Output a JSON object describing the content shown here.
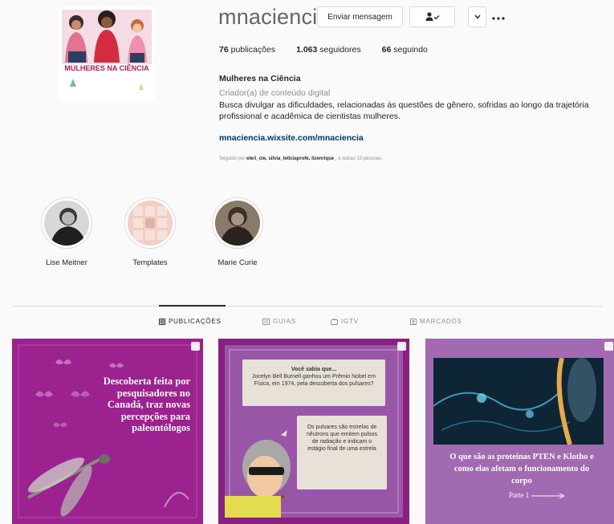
{
  "profile": {
    "username": "mnaciencia",
    "picture_text": "MULHERES NA CIÊNCIA",
    "buttons": {
      "message": "Enviar mensagem",
      "follow_icon": "person-check-icon",
      "more_icon": "chevron-down-icon",
      "options_icon": "ellipsis-icon"
    },
    "stats": {
      "posts_count": "76",
      "posts_label": "publicações",
      "followers_count": "1.063",
      "followers_label": "seguidores",
      "following_count": "66",
      "following_label": "seguindo"
    },
    "bio": {
      "name": "Mulheres na Ciência",
      "category": "Criador(a) de conteúdo digital",
      "text": "Busca divulgar as dificuldades, relacionadas às questões de gênero, sofridas ao longo da trajetória profissional e acadêmica de cientistas mulheres.",
      "link": "mnaciencia.wixsite.com/mnaciencia"
    },
    "followed_by": {
      "prefix": "Seguido por",
      "names": "eleri_cle, silvia_leticiaprofe, lizenrique_",
      "suffix": "e outras 13 pessoas"
    }
  },
  "highlights": [
    {
      "label": "Lise Meitner",
      "icon": "portrait-photo"
    },
    {
      "label": "Templates",
      "icon": "grid-icon"
    },
    {
      "label": "Marie Curie",
      "icon": "portrait-photo"
    }
  ],
  "tabs": [
    {
      "label": "PUBLICAÇÕES",
      "icon": "grid-icon",
      "active": true
    },
    {
      "label": "GUIAS",
      "icon": "guide-icon",
      "active": false
    },
    {
      "label": "IGTV",
      "icon": "igtv-icon",
      "active": false
    },
    {
      "label": "MARCADOS",
      "icon": "tag-icon",
      "active": false
    }
  ],
  "posts": [
    {
      "title": "Descoberta feita por pesquisadores no Canadá, traz novas percepções para paleontólogos",
      "bg": "#9c2290"
    },
    {
      "bubble1_title": "Você sabia que...",
      "bubble1_text": "Jocelyn Bell Burnell ganhou um Prêmio Nobel em Física, em 1974, pela descoberta dos pulsares?",
      "bubble2_text": "Os pulsares são estrelas de nêutrons que emitem pulsos de radiação e indicam o estágio final de uma estrela",
      "bg": "#8a1f82"
    },
    {
      "title": "O que são as proteínas PTEN e Klotho e como elas afetam o funcionamento do corpo",
      "part": "Parte 1",
      "bg": "#a26ab1"
    }
  ]
}
